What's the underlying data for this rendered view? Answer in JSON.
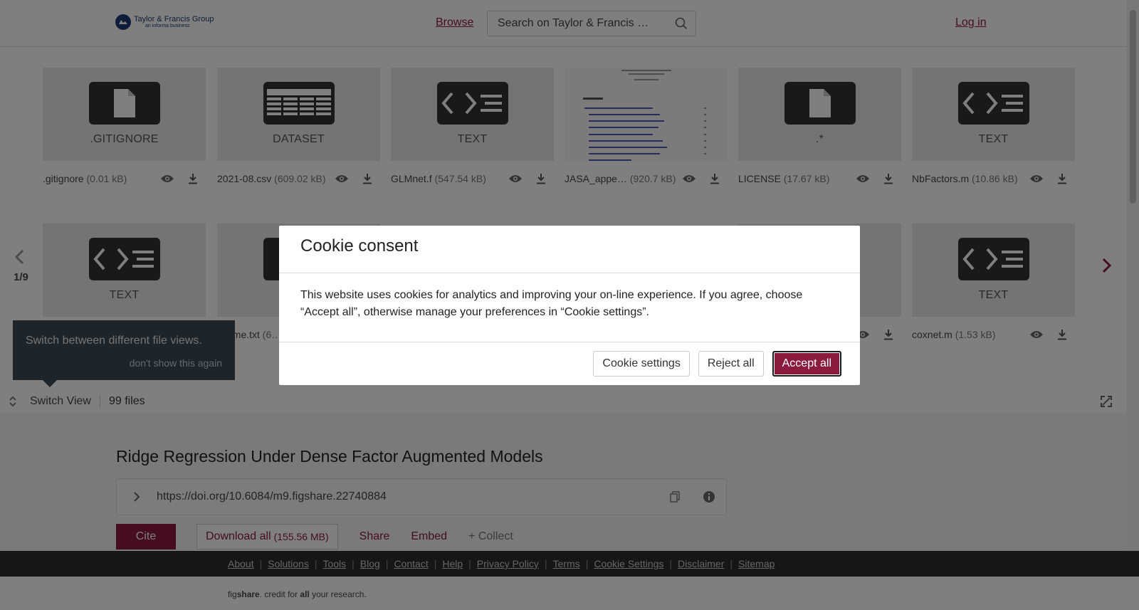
{
  "header": {
    "logo_line1": "Taylor & Francis Group",
    "logo_line2": "an informa business",
    "browse": "Browse",
    "search_placeholder": "Search on Taylor & Francis …",
    "login": "Log in"
  },
  "files": {
    "row1": [
      {
        "label": ".GITIGNORE",
        "icon": "file-icon",
        "name": ".gitignore",
        "size": "(0.01 kB)"
      },
      {
        "label": "DATASET",
        "icon": "table-icon",
        "name": "2021-08.csv",
        "size": "(609.02 kB)"
      },
      {
        "label": "TEXT",
        "icon": "code-icon",
        "name": "GLMnet.f",
        "size": "(547.54 kB)"
      },
      {
        "label": "",
        "icon": "document-preview",
        "name": "JASA_appe…",
        "size": "(920.7 kB)"
      },
      {
        "label": ".*",
        "icon": "file-icon",
        "name": "LICENSE",
        "size": "(17.67 kB)"
      },
      {
        "label": "TEXT",
        "icon": "code-icon",
        "name": "NbFactors.m",
        "size": "(10.86 kB)"
      }
    ],
    "row2": [
      {
        "label": "TEXT",
        "icon": "code-icon",
        "name": "",
        "size": ""
      },
      {
        "label": "",
        "icon": "code-icon",
        "name": "…dme.txt",
        "size": "(6…"
      },
      {
        "label": "TEXT",
        "icon": "code-icon",
        "name": "coxnet.m",
        "size": "(1.53 kB)"
      }
    ],
    "page_indicator": "1/9",
    "tooltip_message": "Switch between different file views.",
    "tooltip_dismiss": "don't show this again",
    "switch_view": "Switch View",
    "files_count": "99 files"
  },
  "article": {
    "title": "Ridge Regression Under Dense Factor Augmented Models",
    "doi": "https://doi.org/10.6084/m9.figshare.22740884",
    "cite": "Cite",
    "download_all": "Download all",
    "download_size": "(155.56 MB)",
    "share": "Share",
    "embed": "Embed",
    "collect": "+ Collect"
  },
  "footer": {
    "links": [
      "About",
      "Solutions",
      "Tools",
      "Blog",
      "Contact",
      "Help",
      "Privacy Policy",
      "Terms",
      "Cookie Settings",
      "Disclaimer",
      "Sitemap"
    ],
    "tagline_fig": "fig",
    "tagline_share": "share",
    "tagline_mid": ". credit for ",
    "tagline_all": "all",
    "tagline_end": " your research."
  },
  "cookie": {
    "title": "Cookie consent",
    "body": "This website uses cookies for analytics and improving your on-line experience. If you agree, choose “Accept all”, otherwise manage your preferences in “Cookie settings”.",
    "settings": "Cookie settings",
    "reject": "Reject all",
    "accept": "Accept all"
  },
  "colors": {
    "brand": "#8b1a3d",
    "footer_bg": "#2c2c2c"
  }
}
